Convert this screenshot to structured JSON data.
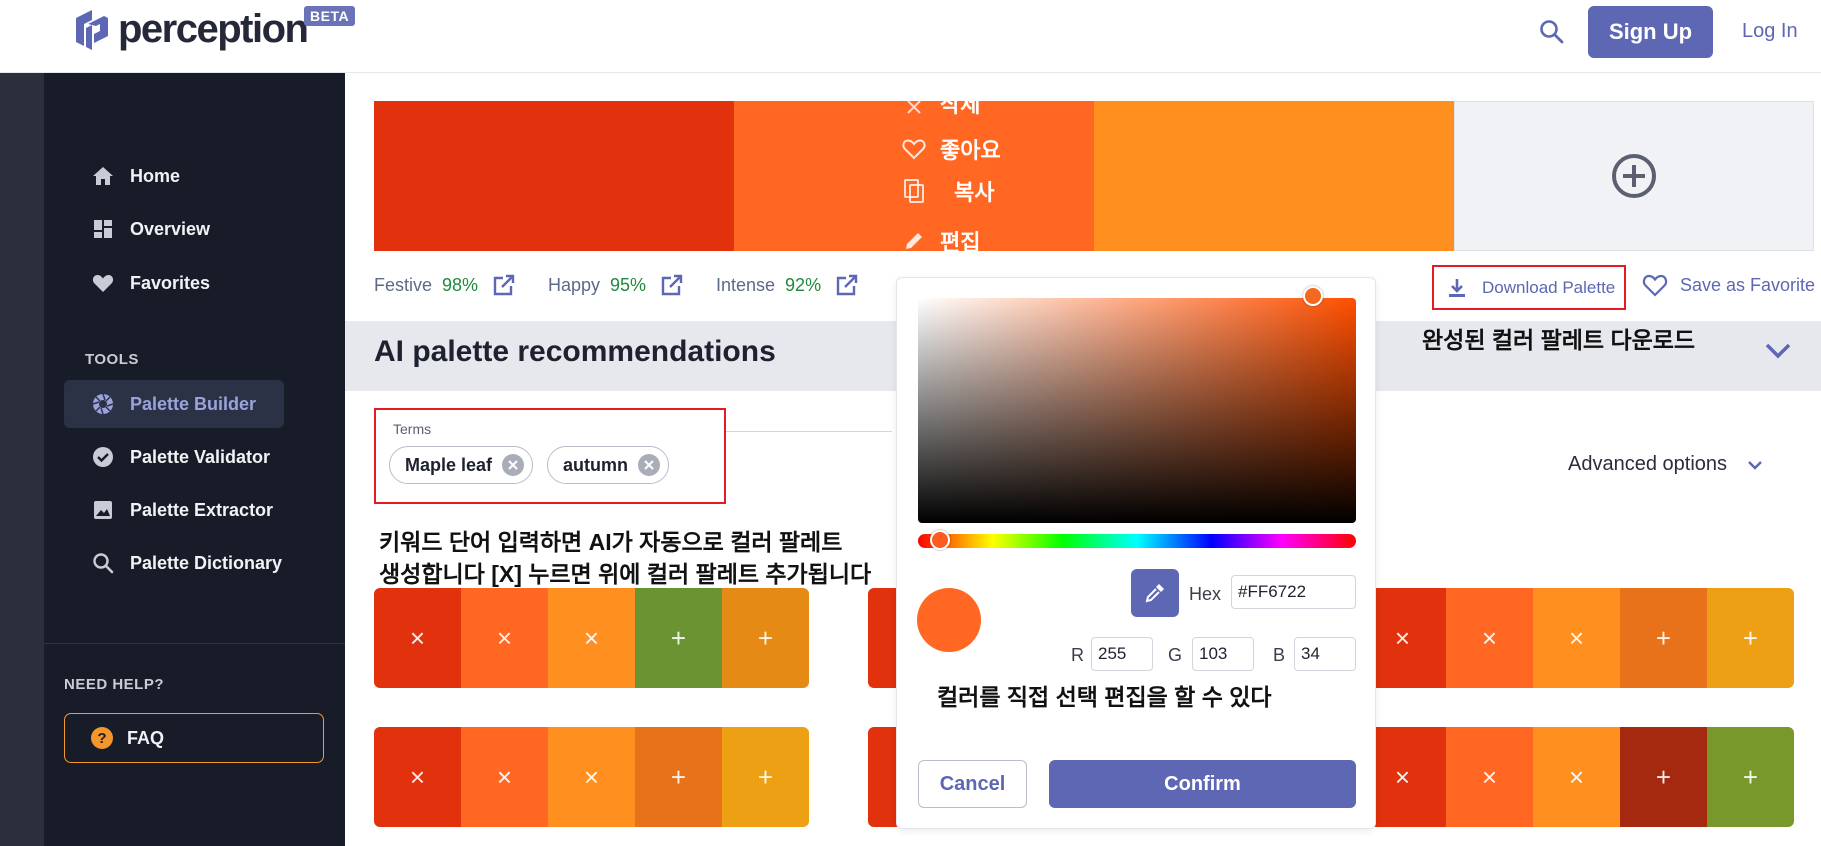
{
  "header": {
    "logo_text": "perception",
    "beta_badge": "BETA",
    "signup_label": "Sign Up",
    "login_label": "Log In"
  },
  "sidebar": {
    "items": [
      {
        "label": "Home",
        "icon": "home-icon"
      },
      {
        "label": "Overview",
        "icon": "dashboard-icon"
      },
      {
        "label": "Favorites",
        "icon": "heart-icon"
      }
    ],
    "tools_label": "TOOLS",
    "tools": [
      {
        "label": "Palette Builder",
        "icon": "aperture-icon",
        "active": true
      },
      {
        "label": "Palette Validator",
        "icon": "check-circle-icon"
      },
      {
        "label": "Palette Extractor",
        "icon": "image-icon"
      },
      {
        "label": "Palette Dictionary",
        "icon": "search-icon"
      }
    ],
    "help_label": "NEED HELP?",
    "faq_label": "FAQ"
  },
  "palette": {
    "colors": [
      "#E1310D",
      "#FF6722",
      "#FF8F1F"
    ],
    "swatch_menu": {
      "delete": "삭제",
      "like": "좋아요",
      "copy": "복사",
      "edit": "편집"
    }
  },
  "moods": [
    {
      "label": "Festive",
      "value": "98%"
    },
    {
      "label": "Happy",
      "value": "95%"
    },
    {
      "label": "Intense",
      "value": "92%"
    }
  ],
  "actions": {
    "download_label": "Download Palette",
    "favorite_label": "Save as Favorite"
  },
  "ai": {
    "title": "AI palette recommendations",
    "terms_label": "Terms",
    "terms": [
      "Maple leaf",
      "autumn"
    ],
    "advanced_label": "Advanced options"
  },
  "annotations": {
    "download": "완성된 컬러 팔레트 다운로드",
    "terms_line1": "키워드 단어 입력하면 AI가 자동으로 컬러 팔레트",
    "terms_line2": "생성합니다 [X] 누르면 위에 컬러 팔레트 추가됩니다",
    "picker": "컬러를 직접 선택 편집을 할 수 있다"
  },
  "recommendations": [
    {
      "colors": [
        "#E1310D",
        "#FF6722",
        "#FF8F1F",
        "#6A9431",
        "#E48A15"
      ],
      "marks": [
        "×",
        "×",
        "×",
        "+",
        "+"
      ]
    },
    {
      "colors": [
        "#E1310D",
        "#FF6722",
        "#FF8F1F",
        "#E8721A",
        "#EDA014"
      ],
      "marks": [
        "×",
        "×",
        "×",
        "+",
        "+"
      ]
    },
    {
      "colors": [
        "#E1310D",
        "#FF6722",
        "#FF8F1F",
        "#E8721A",
        "#EDA014"
      ],
      "marks": [
        "×",
        "×",
        "×",
        "+",
        "+"
      ]
    },
    {
      "colors": [
        "#E1310D",
        "#FF6722",
        "#FF8F1F",
        "#A5290F",
        "#78982B"
      ],
      "marks": [
        "×",
        "×",
        "×",
        "+",
        "+"
      ]
    }
  ],
  "picker": {
    "hex_label": "Hex",
    "hex_value": "#FF6722",
    "r_label": "R",
    "r_value": "255",
    "g_label": "G",
    "g_value": "103",
    "b_label": "B",
    "b_value": "34",
    "cancel_label": "Cancel",
    "confirm_label": "Confirm"
  }
}
